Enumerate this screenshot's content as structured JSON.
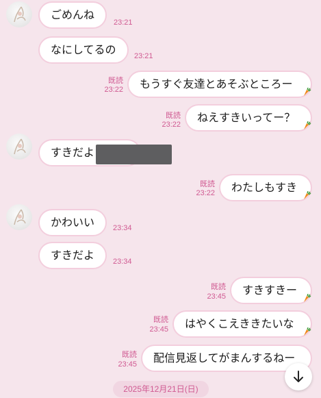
{
  "messages": [
    {
      "text": "ごめんね",
      "time": "23:21",
      "read": ""
    },
    {
      "text": "なにしてるの",
      "time": "23:21",
      "read": ""
    },
    {
      "text": "もうすぐ友達とあそぶところー",
      "time": "23:22",
      "read": "既読"
    },
    {
      "text": "ねえすきいってー？",
      "time": "23:22",
      "read": "既読"
    },
    {
      "text": "すきだよ",
      "time": "",
      "read": ""
    },
    {
      "text": "わたしもすき",
      "time": "23:22",
      "read": "既読"
    },
    {
      "text": "かわいい",
      "time": "23:34",
      "read": ""
    },
    {
      "text": "すきだよ",
      "time": "23:34",
      "read": ""
    },
    {
      "text": "すきすきー",
      "time": "23:45",
      "read": "既読"
    },
    {
      "text": "はやくこえききたいな",
      "time": "23:45",
      "read": "既読"
    },
    {
      "text": "配信見返してがまんするねー",
      "time": "23:45",
      "read": "既読"
    }
  ],
  "date_label": "2025年12月21日(日)",
  "icons": {
    "avatar": "avatar-rabbit-icon",
    "reaction": "carrot-icon",
    "scroll": "arrow-down-icon"
  },
  "colors": {
    "background": "#f6e5ec",
    "bubble_border": "#f3cedd",
    "accent": "#d05a92"
  }
}
